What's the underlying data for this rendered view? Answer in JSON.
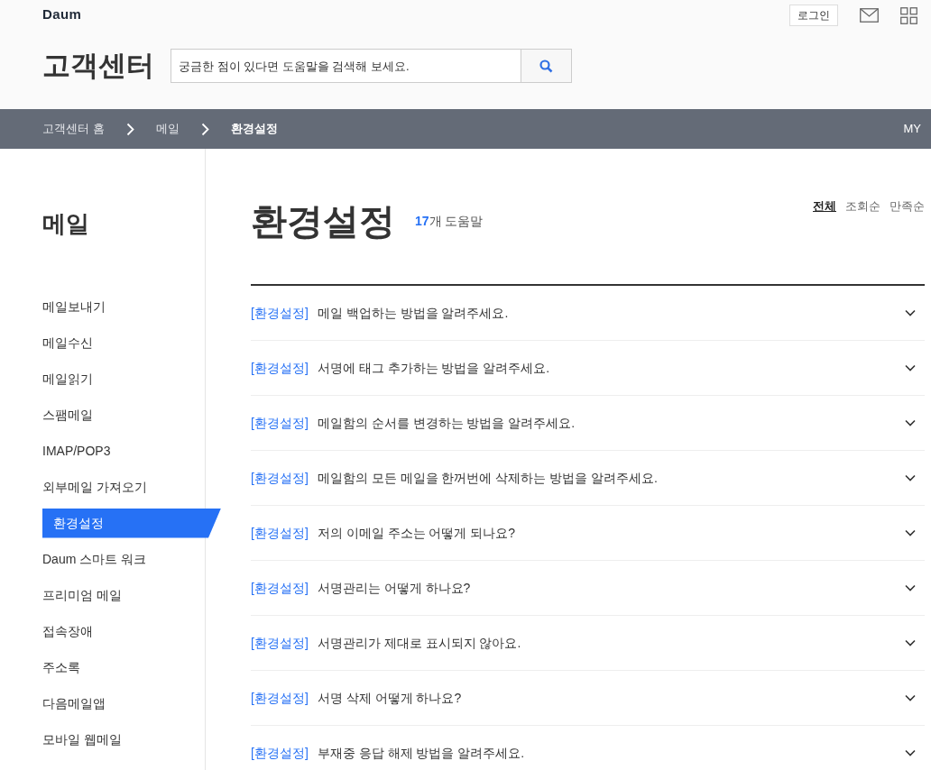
{
  "header": {
    "logo": "Daum",
    "login_button": "로그인",
    "title": "고객센터",
    "search": {
      "placeholder": "궁금한 점이 있다면 도움말을 검색해 보세요."
    }
  },
  "breadcrumb": {
    "items": [
      "고객센터 홈",
      "메일",
      "환경설정"
    ],
    "my_link": "MY"
  },
  "sidebar": {
    "title": "메일",
    "items": [
      {
        "label": "메일보내기",
        "selected": false
      },
      {
        "label": "메일수신",
        "selected": false
      },
      {
        "label": "메일읽기",
        "selected": false
      },
      {
        "label": "스팸메일",
        "selected": false
      },
      {
        "label": "IMAP/POP3",
        "selected": false
      },
      {
        "label": "외부메일 가져오기",
        "selected": false
      },
      {
        "label": "환경설정",
        "selected": true
      },
      {
        "label": "Daum 스마트 워크",
        "selected": false
      },
      {
        "label": "프리미엄 메일",
        "selected": false
      },
      {
        "label": "접속장애",
        "selected": false
      },
      {
        "label": "주소록",
        "selected": false
      },
      {
        "label": "다음메일앱",
        "selected": false
      },
      {
        "label": "모바일 웹메일",
        "selected": false
      }
    ]
  },
  "main": {
    "title": "환경설정",
    "count": "17",
    "count_suffix": "개 도움말",
    "sort_options": [
      {
        "label": "전체",
        "selected": true
      },
      {
        "label": "조회순",
        "selected": false
      },
      {
        "label": "만족순",
        "selected": false
      }
    ],
    "faq": [
      {
        "category": "[환경설정]",
        "question": "메일 백업하는 방법을 알려주세요."
      },
      {
        "category": "[환경설정]",
        "question": "서명에 태그 추가하는 방법을 알려주세요."
      },
      {
        "category": "[환경설정]",
        "question": "메일함의 순서를 변경하는 방법을 알려주세요."
      },
      {
        "category": "[환경설정]",
        "question": "메일함의 모든 메일을 한꺼번에 삭제하는 방법을 알려주세요."
      },
      {
        "category": "[환경설정]",
        "question": "저의 이메일 주소는 어떻게 되나요?"
      },
      {
        "category": "[환경설정]",
        "question": "서명관리는 어떻게 하나요?"
      },
      {
        "category": "[환경설정]",
        "question": "서명관리가 제대로 표시되지 않아요."
      },
      {
        "category": "[환경설정]",
        "question": "서명 삭제 어떻게 하나요?"
      },
      {
        "category": "[환경설정]",
        "question": "부재중 응답 해제 방법을 알려주세요."
      }
    ]
  }
}
